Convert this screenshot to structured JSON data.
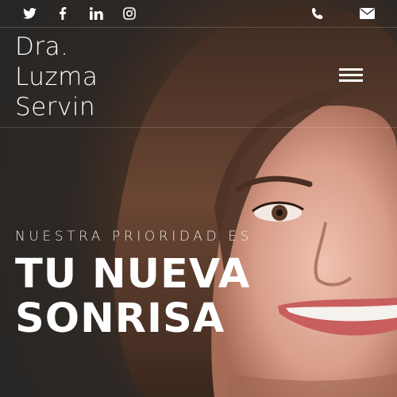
{
  "social": [
    {
      "name": "twitter-icon"
    },
    {
      "name": "facebook-icon"
    },
    {
      "name": "linkedin-icon"
    },
    {
      "name": "instagram-icon"
    }
  ],
  "contact": [
    {
      "name": "phone-icon"
    },
    {
      "name": "email-icon"
    }
  ],
  "brand": {
    "line1": "Dra.",
    "line2": "Luzma",
    "line3": "Servin"
  },
  "hero": {
    "tagline": "NUESTRA PRIORIDAD ES",
    "headline_line1": "TU NUEVA",
    "headline_line2": "SONRISA"
  },
  "colors": {
    "text": "#ffffff",
    "background": "#2b2a29"
  }
}
